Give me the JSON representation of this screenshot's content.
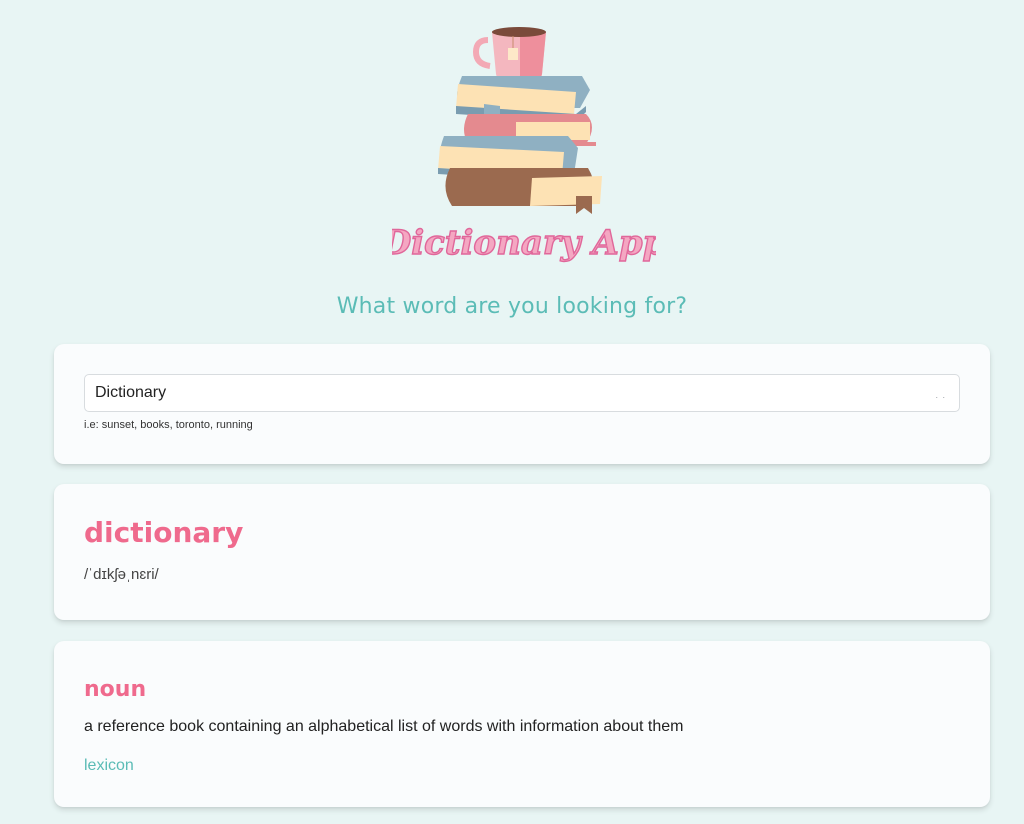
{
  "header": {
    "logo_text": "Dictionary App",
    "prompt": "What word are you looking for?"
  },
  "search": {
    "value": "Dictionary",
    "hint": "i.e: sunset, books, toronto, running",
    "indicator": ". ."
  },
  "result": {
    "word": "dictionary",
    "phonetic": "/ˈdɪkʃəˌnɛri/",
    "meanings": [
      {
        "part_of_speech": "noun",
        "definition": "a reference book containing an alphabetical list of words with information about them",
        "synonyms": [
          "lexicon"
        ]
      }
    ]
  },
  "colors": {
    "background": "#e8f5f4",
    "accent_teal": "#5bbcb6",
    "accent_pink": "#ef6a8d",
    "card": "#fafcfd"
  }
}
